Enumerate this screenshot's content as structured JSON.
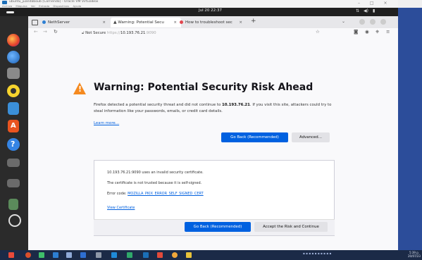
{
  "vbox": {
    "title": "ubuntu_juandaboub [Corriendo] - Oracle VM VirtualBox",
    "menu": [
      "Archivo",
      "Máquina",
      "Ver",
      "Entrada",
      "Dispositivos",
      "Ayuda"
    ],
    "controls": [
      "–",
      "□",
      "×"
    ]
  },
  "gnome": {
    "clock": "Jul 20  22:37",
    "status_icons": [
      "network-icon",
      "volume-icon",
      "battery-icon"
    ]
  },
  "dock": {
    "apps": [
      "firefox-icon",
      "thunderbird-icon",
      "files-icon",
      "rhythmbox-icon",
      "libreoffice-writer-icon",
      "app-center-icon",
      "help-icon",
      "disk-icon",
      "disk2-icon",
      "trash-icon",
      "settings-icon"
    ]
  },
  "tabs": [
    {
      "title": "NethServer",
      "favicon_color": "#2d7fd3"
    },
    {
      "title": "Warning: Potential Secu",
      "favicon_color": "#444444",
      "active": true
    },
    {
      "title": "How to troubleshoot sec",
      "favicon_color": "#e2474f"
    }
  ],
  "navbar": {
    "not_secure": "Not Secure",
    "url_scheme": "https://",
    "url_host": "10.193.76.21",
    "url_port": ":9090"
  },
  "page": {
    "heading": "Warning: Potential Security Risk Ahead",
    "intro_before": "Firefox detected a potential security threat and did not continue to ",
    "intro_host": "10.193.76.21",
    "intro_after": ". If you visit this site, attackers could try to steal information like your passwords, emails, or credit card details.",
    "learn_more": "Learn more…",
    "go_back": "Go Back (Recommended)",
    "advanced": "Advanced…",
    "adv_line1": "10.193.76.21:9090 uses an invalid security certificate.",
    "adv_line2": "The certificate is not trusted because it is self-signed.",
    "adv_error_label": "Error code: ",
    "adv_error_code": "MOZILLA_PKIX_ERROR_SELF_SIGNED_CERT",
    "view_certificate": "View Certificate",
    "go_back2": "Go Back (Recommended)",
    "accept_risk": "Accept the Risk and Continue"
  },
  "taskbar": {
    "time": "5:39 p.",
    "date": "20/07/23",
    "accent": "#1b2a47"
  }
}
